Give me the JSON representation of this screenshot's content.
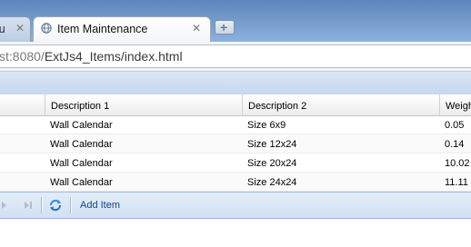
{
  "browser": {
    "tabs": [
      {
        "title": "ctu",
        "active": false
      },
      {
        "title": "Item Maintenance",
        "active": true
      }
    ],
    "close_glyph": "✕",
    "newtab_glyph": "+",
    "url_dim": "st:8080/",
    "url_path": "ExtJs4_Items/index.html"
  },
  "grid": {
    "columns": [
      "Description 1",
      "Description 2",
      "Weigh"
    ],
    "rows": [
      [
        "Wall Calendar",
        "Size 6x9",
        "0.05"
      ],
      [
        "Wall Calendar",
        "Size 12x24",
        "0.14"
      ],
      [
        "Wall Calendar",
        "Size 20x24",
        "10.02"
      ],
      [
        "Wall Calendar",
        "Size 24x24",
        "11.11"
      ]
    ]
  },
  "paging_toolbar": {
    "add_item_label": "Add Item",
    "icons": [
      "next-page-icon",
      "last-page-icon",
      "refresh-icon"
    ]
  },
  "colors": {
    "tabstrip": "#6f95c9",
    "header_bar": "#c6d8ef",
    "toolbar_text": "#15428b"
  }
}
